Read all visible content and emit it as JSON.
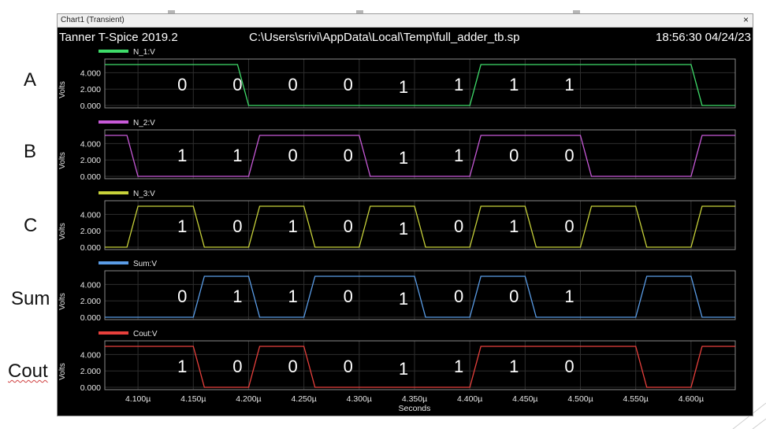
{
  "window": {
    "title": "Chart1 (Transient)",
    "close_glyph": "×"
  },
  "header": {
    "app": "Tanner T-Spice 2019.2",
    "file": "C:\\Users\\srivi\\AppData\\Local\\Temp\\full_adder_tb.sp",
    "timestamp": "18:56:30 04/24/23"
  },
  "side_labels": [
    "A",
    "B",
    "C",
    "Sum",
    "Cout"
  ],
  "colors": {
    "N_1": "#3fdc6a",
    "N_2": "#c85ad8",
    "N_3": "#c8d23a",
    "Sum": "#5a9ce6",
    "Cout": "#e8403c"
  },
  "chart_data": {
    "type": "line",
    "x_unit": "µs",
    "xlabel": "Seconds",
    "xlim": [
      4.07,
      4.64
    ],
    "x_ticks": [
      4.1,
      4.15,
      4.2,
      4.25,
      4.3,
      4.35,
      4.4,
      4.45,
      4.5,
      4.55,
      4.6
    ],
    "x_tick_labels": [
      "4.100µ",
      "4.150µ",
      "4.200µ",
      "4.250µ",
      "4.300µ",
      "4.350µ",
      "4.400µ",
      "4.450µ",
      "4.500µ",
      "4.550µ",
      "4.600µ"
    ],
    "ylabel": "Volts",
    "ylim": [
      0,
      5
    ],
    "y_ticks": [
      0,
      2,
      4
    ],
    "y_tick_labels": [
      "0.000",
      "2.000",
      "4.000"
    ],
    "grid": true,
    "series": [
      {
        "name": "N_1:V",
        "x": [
          4.07,
          4.19,
          4.2,
          4.4,
          4.41,
          4.6,
          4.61,
          4.64
        ],
        "y": [
          5,
          5,
          0,
          0,
          5,
          5,
          0,
          0
        ]
      },
      {
        "name": "N_2:V",
        "x": [
          4.07,
          4.09,
          4.1,
          4.2,
          4.21,
          4.3,
          4.31,
          4.4,
          4.41,
          4.5,
          4.51,
          4.6,
          4.61,
          4.64
        ],
        "y": [
          5,
          5,
          0,
          0,
          5,
          5,
          0,
          0,
          5,
          5,
          0,
          0,
          5,
          5
        ]
      },
      {
        "name": "N_3:V",
        "x": [
          4.07,
          4.09,
          4.1,
          4.15,
          4.16,
          4.2,
          4.21,
          4.25,
          4.26,
          4.3,
          4.31,
          4.35,
          4.36,
          4.4,
          4.41,
          4.45,
          4.46,
          4.5,
          4.51,
          4.55,
          4.56,
          4.6,
          4.61,
          4.64
        ],
        "y": [
          0,
          0,
          5,
          5,
          0,
          0,
          5,
          5,
          0,
          0,
          5,
          5,
          0,
          0,
          5,
          5,
          0,
          0,
          5,
          5,
          0,
          0,
          5,
          5
        ]
      },
      {
        "name": "Sum:V",
        "x": [
          4.07,
          4.15,
          4.16,
          4.2,
          4.21,
          4.25,
          4.26,
          4.3,
          4.31,
          4.35,
          4.36,
          4.4,
          4.41,
          4.45,
          4.46,
          4.55,
          4.56,
          4.6,
          4.61,
          4.64
        ],
        "y": [
          0,
          0,
          5,
          5,
          0,
          0,
          5,
          5,
          5,
          5,
          0,
          0,
          5,
          5,
          0,
          0,
          5,
          5,
          0,
          0
        ]
      },
      {
        "name": "Cout:V",
        "x": [
          4.07,
          4.15,
          4.16,
          4.2,
          4.21,
          4.25,
          4.26,
          4.4,
          4.41,
          4.55,
          4.56,
          4.6,
          4.61,
          4.64
        ],
        "y": [
          5,
          5,
          0,
          0,
          5,
          5,
          0,
          0,
          5,
          5,
          0,
          0,
          5,
          5
        ]
      }
    ],
    "annotations": {
      "x": [
        4.14,
        4.19,
        4.24,
        4.29,
        4.34,
        4.39,
        4.44,
        4.49
      ],
      "rows": [
        [
          "0",
          "0",
          "0",
          "0",
          "1",
          "1",
          "1",
          "1"
        ],
        [
          "1",
          "1",
          "0",
          "0",
          "1",
          "1",
          "0",
          "0"
        ],
        [
          "1",
          "0",
          "1",
          "0",
          "1",
          "0",
          "1",
          "0"
        ],
        [
          "0",
          "1",
          "1",
          "0",
          "1",
          "0",
          "0",
          "1"
        ],
        [
          "1",
          "0",
          "0",
          "0",
          "1",
          "1",
          "1",
          "0"
        ]
      ]
    }
  }
}
